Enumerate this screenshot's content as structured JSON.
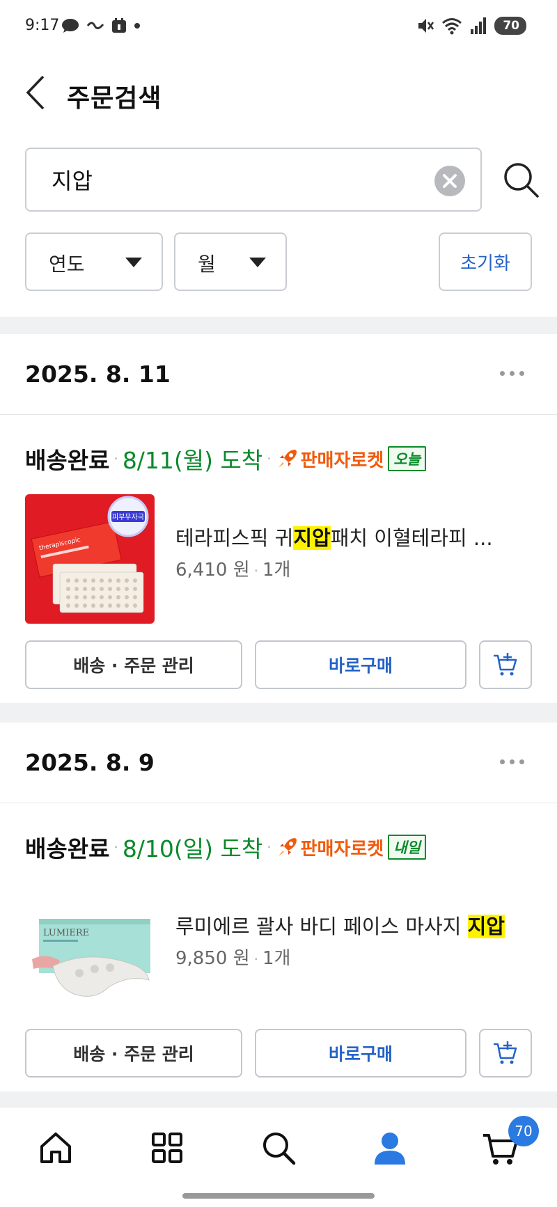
{
  "status_bar": {
    "time": "9:17",
    "battery": "70"
  },
  "header": {
    "title": "주문검색"
  },
  "search": {
    "value": "지압"
  },
  "filters": {
    "year": "연도",
    "month": "월",
    "reset": "초기화"
  },
  "orders": [
    {
      "date": "2025. 8. 11",
      "status": "배송완료",
      "arrival": "8/11(월) 도착",
      "seller_rocket": "판매자로켓",
      "day_badge": "오늘",
      "thumb_badge": "피부무자극",
      "thumb_brand": "therapiscopic",
      "product_prefix": "테라피스픽 귀",
      "product_highlight": "지압",
      "product_suffix": "패치 이혈테라피 ...",
      "price": "6,410 원",
      "quantity": "1개",
      "manage_label": "배송 · 주문 관리",
      "buy_label": "바로구매"
    },
    {
      "date": "2025. 8. 9",
      "status": "배송완료",
      "arrival": "8/10(일) 도착",
      "seller_rocket": "판매자로켓",
      "day_badge": "내일",
      "thumb_brand": "LUMIERE",
      "product_prefix": "루미에르 괄사 바디 페이스 마사지 ",
      "product_highlight": "지압",
      "product_suffix": "",
      "price": "9,850 원",
      "quantity": "1개",
      "manage_label": "배송 · 주문 관리",
      "buy_label": "바로구매"
    }
  ],
  "bottom_nav": {
    "cart_count": "70"
  },
  "colors": {
    "accent_blue": "#2463c7",
    "arrival_green": "#0b8a2b",
    "rocket_orange": "#f25a0b",
    "highlight": "#fff200"
  }
}
